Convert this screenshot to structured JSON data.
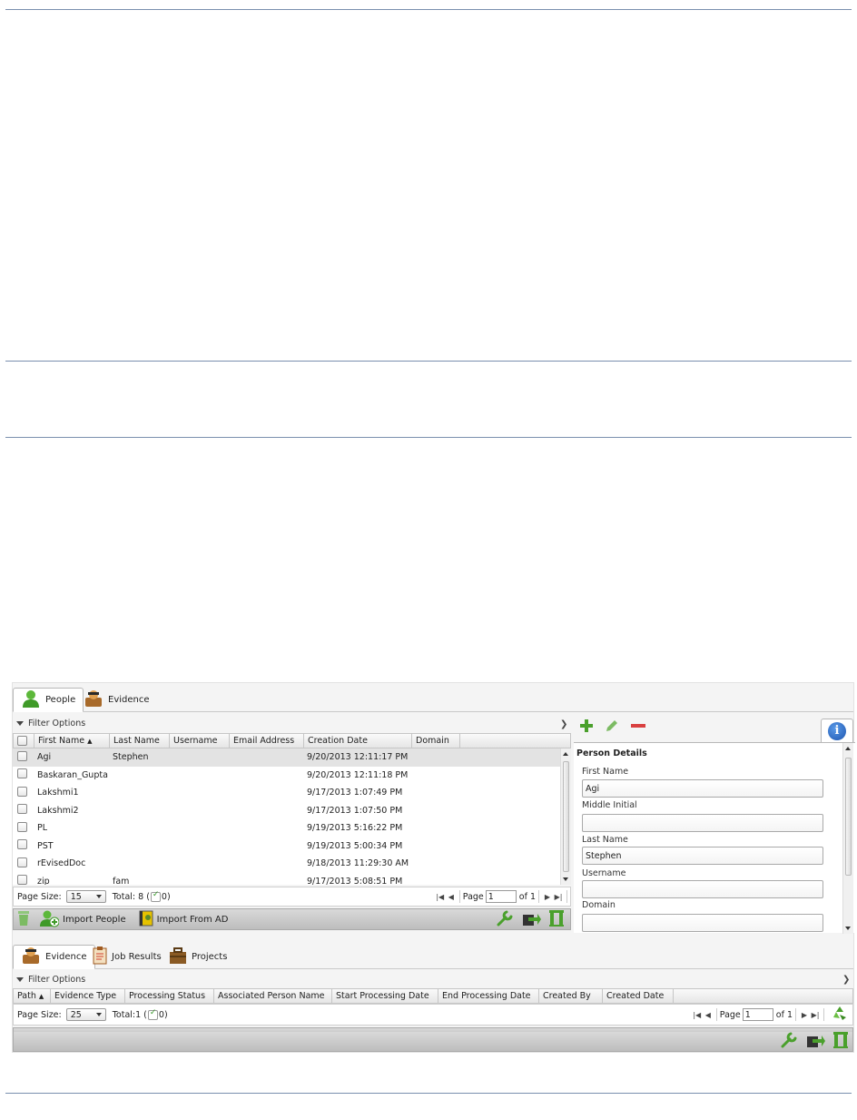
{
  "top_tabs": [
    {
      "label": "People",
      "icon": "person-icon",
      "active": true
    },
    {
      "label": "Evidence",
      "icon": "evidence-icon",
      "active": false
    }
  ],
  "people_grid": {
    "filter_label": "Filter Options",
    "columns": [
      "First Name",
      "Last Name",
      "Username",
      "Email Address",
      "Creation Date",
      "Domain"
    ],
    "rows": [
      {
        "first": "Agi",
        "last": "Stephen",
        "username": "",
        "email": "",
        "created": "9/20/2013 12:11:17 PM",
        "domain": "",
        "selected": true
      },
      {
        "first": "Baskaran_Gupta",
        "last": "",
        "username": "",
        "email": "",
        "created": "9/20/2013 12:11:18 PM",
        "domain": ""
      },
      {
        "first": "Lakshmi1",
        "last": "",
        "username": "",
        "email": "",
        "created": "9/17/2013 1:07:49 PM",
        "domain": ""
      },
      {
        "first": "Lakshmi2",
        "last": "",
        "username": "",
        "email": "",
        "created": "9/17/2013 1:07:50 PM",
        "domain": ""
      },
      {
        "first": "PL",
        "last": "",
        "username": "",
        "email": "",
        "created": "9/19/2013 5:16:22 PM",
        "domain": ""
      },
      {
        "first": "PST",
        "last": "",
        "username": "",
        "email": "",
        "created": "9/19/2013 5:00:34 PM",
        "domain": ""
      },
      {
        "first": "rEvisedDoc",
        "last": "",
        "username": "",
        "email": "",
        "created": "9/18/2013 11:29:30 AM",
        "domain": ""
      },
      {
        "first": "zip",
        "last": "fam",
        "username": "",
        "email": "",
        "created": "9/17/2013 5:08:51 PM",
        "domain": ""
      }
    ],
    "pager": {
      "page_size_label": "Page Size:",
      "page_size": "15",
      "total_label": "Total: 8 (",
      "checked_count": "0)",
      "page_label": "Page",
      "page": "1",
      "of_label": "of 1"
    },
    "toolbar": {
      "import_people": "Import People",
      "import_ad": "Import From AD"
    }
  },
  "details": {
    "title": "Person Details",
    "fields": [
      {
        "label": "First Name",
        "value": "Agi"
      },
      {
        "label": "Middle Initial",
        "value": ""
      },
      {
        "label": "Last Name",
        "value": "Stephen"
      },
      {
        "label": "Username",
        "value": ""
      },
      {
        "label": "Domain",
        "value": ""
      }
    ]
  },
  "bottom_tabs": [
    {
      "label": "Evidence",
      "icon": "evidence-icon",
      "active": true
    },
    {
      "label": "Job Results",
      "icon": "clipboard-icon",
      "active": false
    },
    {
      "label": "Projects",
      "icon": "briefcase-icon",
      "active": false
    }
  ],
  "evidence_grid": {
    "filter_label": "Filter Options",
    "columns": [
      "Path",
      "Evidence Type",
      "Processing Status",
      "Associated Person Name",
      "Start Processing Date",
      "End Processing Date",
      "Created By",
      "Created Date"
    ],
    "pager": {
      "page_size_label": "Page Size:",
      "page_size": "25",
      "total_label": "Total:1 (",
      "checked_count": "0)",
      "page_label": "Page",
      "page": "1",
      "of_label": "of 1"
    }
  },
  "colors": {
    "rule": "#7a8fae",
    "accent_green": "#4aa02c",
    "info_blue": "#2466c4"
  }
}
